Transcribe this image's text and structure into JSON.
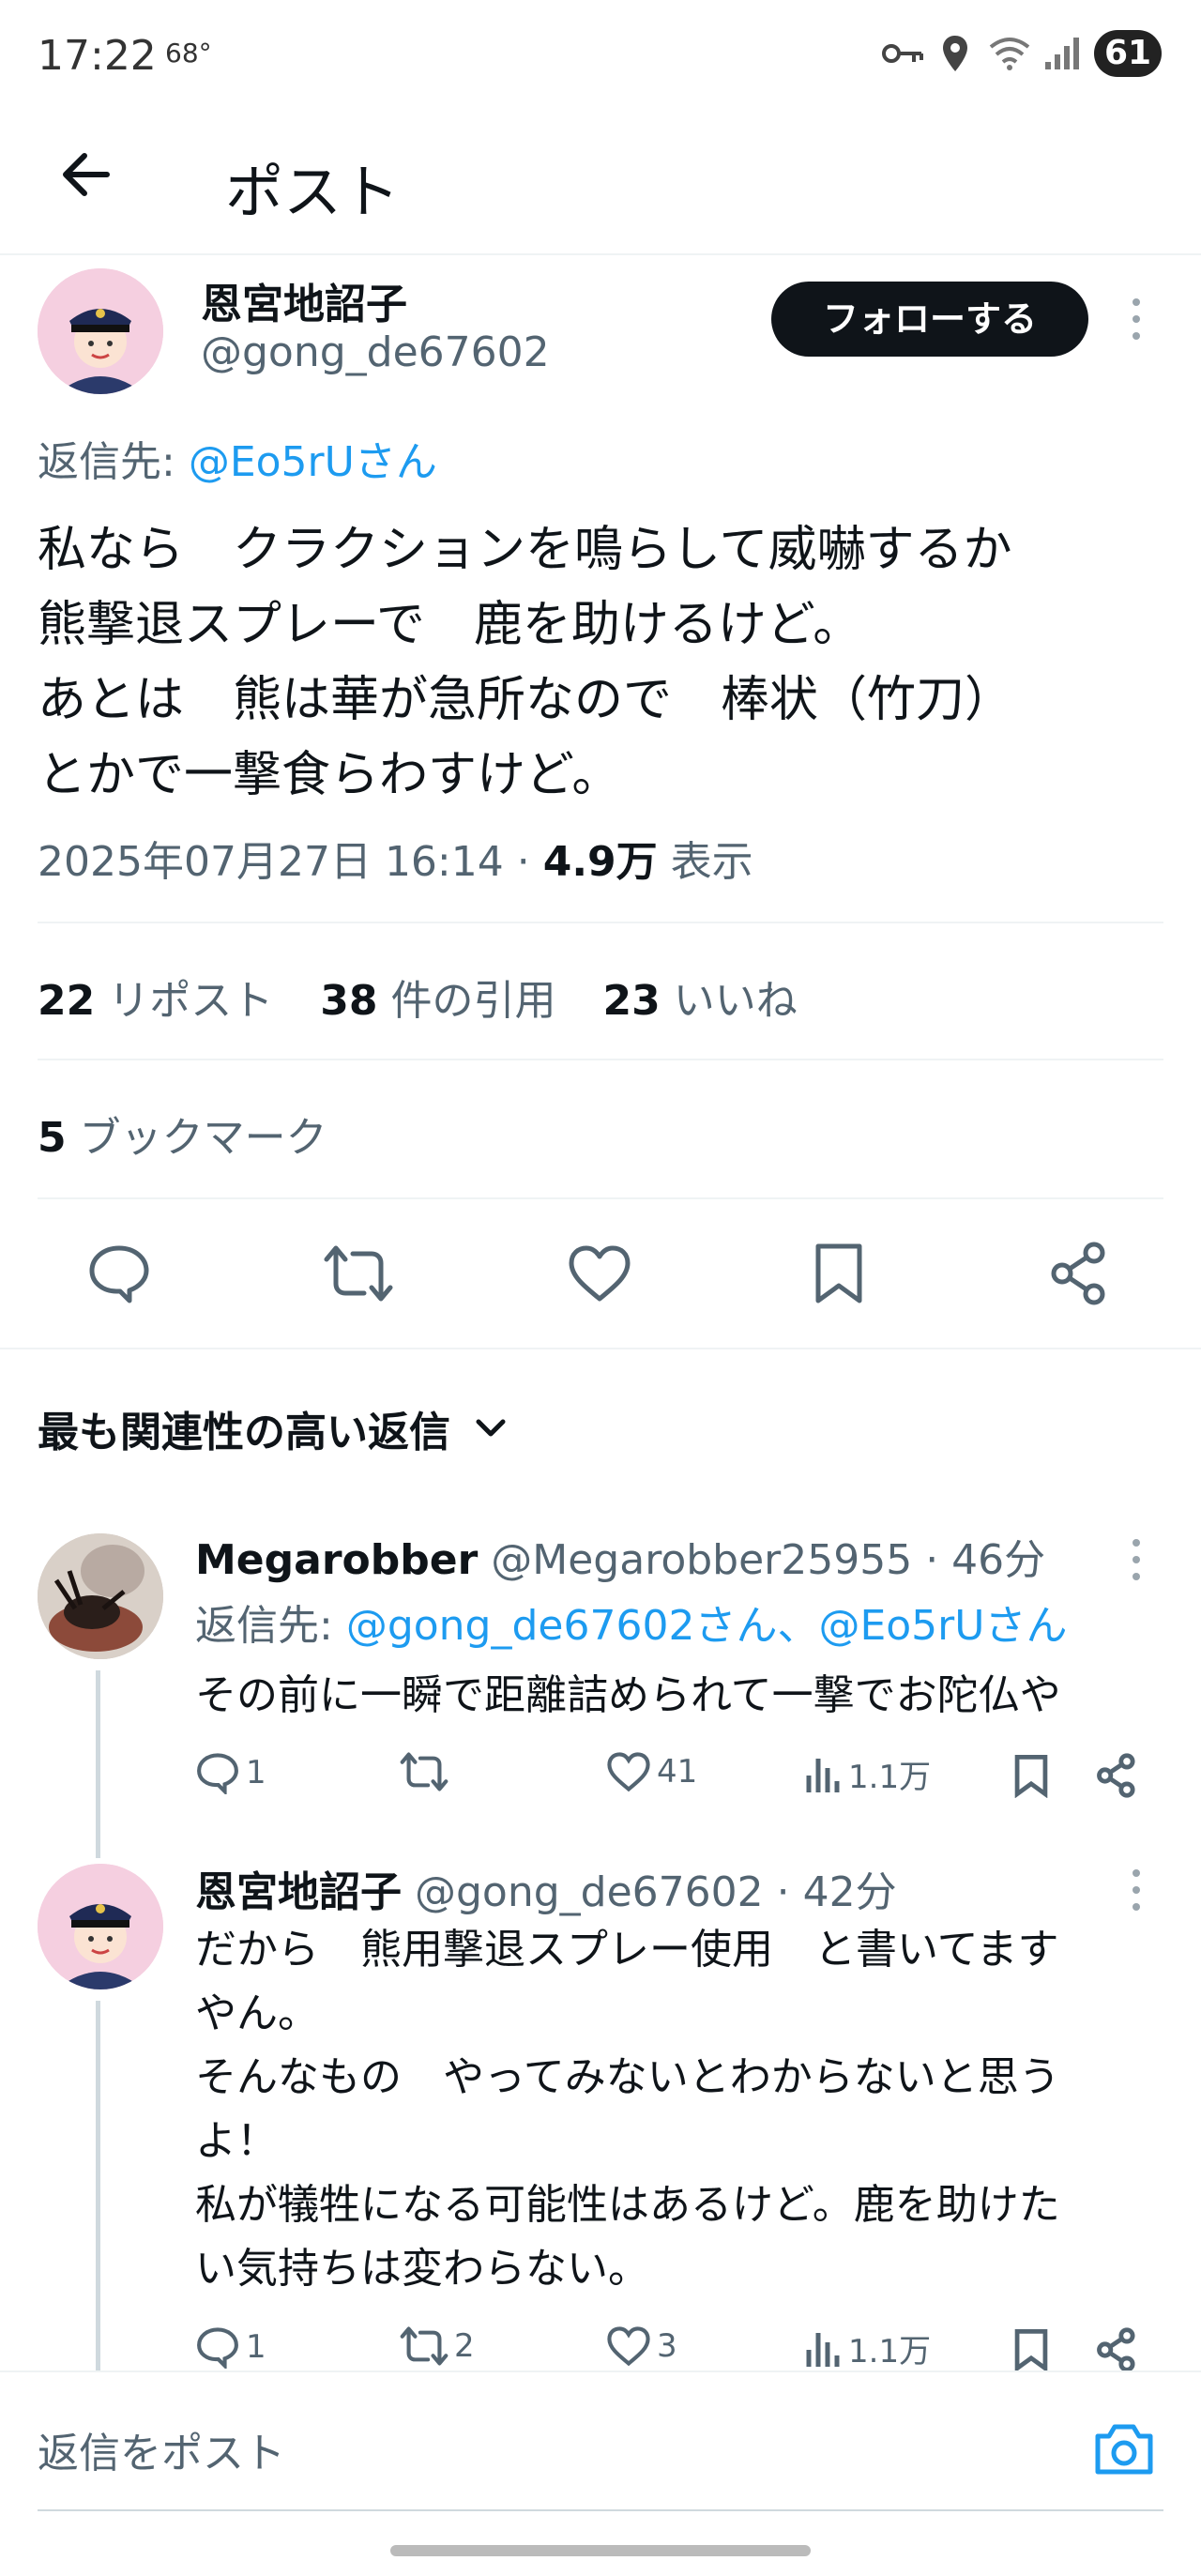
{
  "status_bar": {
    "time": "17:22",
    "temp": "68°",
    "battery": "61"
  },
  "header": {
    "title": "ポスト"
  },
  "post": {
    "author_name": "恩宮地詔子",
    "handle": "@gong_de67602",
    "follow_label": "フォローする",
    "reply_to_prefix": "返信先: ",
    "reply_to_user": "@Eo5rUさん",
    "text_lines": [
      "私なら　クラクションを鳴らして威嚇するか",
      "熊撃退スプレーで　鹿を助けるけど。",
      "あとは　熊は華が急所なので　棒状（竹刀）",
      "とかで一撃食らわすけど。"
    ],
    "timestamp": "2025年07月27日 16:14 · ",
    "views_count": "4.9万",
    "views_label": " 表示",
    "reposts_count": "22",
    "reposts_label": " リポスト",
    "quotes_count": "38",
    "quotes_label": " 件の引用",
    "likes_count": "23",
    "likes_label": " いいね",
    "bookmarks_count": "5",
    "bookmarks_label": " ブックマーク"
  },
  "replies_section": {
    "label": "最も関連性の高い返信"
  },
  "replies": [
    {
      "name": "Megarobber",
      "handle_time": " @Megarobber25955 · 46分",
      "reply_prefix": "返信先: ",
      "reply_users": "@gong_de67602さん、@Eo5rUさん",
      "text": "その前に一瞬で距離詰められて一撃でお陀仏や",
      "replies": "1",
      "reposts": "",
      "likes": "41",
      "views": "1.1万"
    },
    {
      "name": "恩宮地詔子",
      "handle_time": " @gong_de67602 · 42分",
      "text_lines": [
        "だから　熊用撃退スプレー使用　と書いてます",
        "やん。",
        "そんなもの　やってみないとわからないと思う",
        "よ！",
        "私が犠牲になる可能性はあるけど。鹿を助けた",
        "い気持ちは変わらない。"
      ],
      "replies": "1",
      "reposts": "2",
      "likes": "3",
      "views": "1.1万"
    }
  ],
  "reply_bar": {
    "placeholder": "返信をポスト"
  },
  "colors": {
    "accent": "#1d9bf0",
    "text": "#0f1419",
    "muted": "#536471"
  }
}
